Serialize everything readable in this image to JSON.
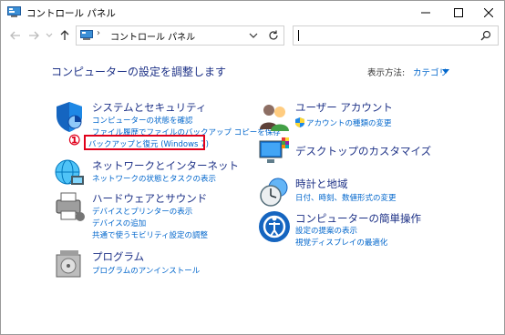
{
  "window": {
    "title": "コントロール パネル"
  },
  "address_bar": {
    "separator": "›",
    "path": "コントロール パネル",
    "search_placeholder": ""
  },
  "main": {
    "heading": "コンピューターの設定を調整します",
    "view_by_label": "表示方法:",
    "view_by_value": "カテゴリ"
  },
  "annotation": {
    "marker": "①"
  },
  "categories": {
    "system": {
      "title": "システムとセキュリティ",
      "links": [
        "コンピューターの状態を確認",
        "ファイル履歴でファイルのバックアップ コピーを保存",
        "バックアップと復元 (Windows 7)"
      ]
    },
    "network": {
      "title": "ネットワークとインターネット",
      "links": [
        "ネットワークの状態とタスクの表示"
      ]
    },
    "hardware": {
      "title": "ハードウェアとサウンド",
      "links": [
        "デバイスとプリンターの表示",
        "デバイスの追加",
        "共通で使うモビリティ設定の調整"
      ]
    },
    "programs": {
      "title": "プログラム",
      "links": [
        "プログラムのアンインストール"
      ]
    },
    "users": {
      "title": "ユーザー アカウント",
      "links": [
        "アカウントの種類の変更"
      ]
    },
    "appearance": {
      "title": "デスクトップのカスタマイズ",
      "links": []
    },
    "clock": {
      "title": "時計と地域",
      "links": [
        "日付、時刻、数値形式の変更"
      ]
    },
    "ease": {
      "title": "コンピューターの簡単操作",
      "links": [
        "設定の提案の表示",
        "視覚ディスプレイの最適化"
      ]
    }
  },
  "colors": {
    "link": "#0066cc",
    "category_title": "#1e3287",
    "highlight": "#e0001b"
  }
}
